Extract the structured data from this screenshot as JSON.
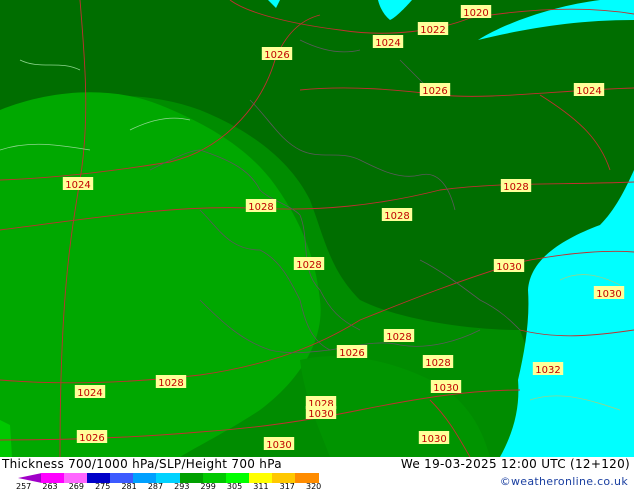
{
  "title": "Thickness 700/1000 hPa/SLP/Height 700 hPa",
  "valid_time": "We 19-03-2025 12:00 UTC (12+120)",
  "credit": "©weatheronline.co.uk",
  "colors": {
    "ocean": "#00ffff",
    "dark_green": "#006e00",
    "mid_green": "#008c00",
    "light_green": "#00a800",
    "isobar": "#c03030",
    "border": "#5a5a5a",
    "label_bg": "#ffff99",
    "label_text": "#c00000"
  },
  "scale": {
    "ticks": [
      "257",
      "263",
      "269",
      "275",
      "281",
      "287",
      "293",
      "299",
      "305",
      "311",
      "317",
      "320"
    ],
    "colors": [
      "#a000c8",
      "#ff00ff",
      "#ff66ff",
      "#0000c8",
      "#3c5aff",
      "#00a0ff",
      "#00d2ff",
      "#00a000",
      "#00c800",
      "#00ff00",
      "#ffff00",
      "#ffc800",
      "#ff8c00"
    ]
  },
  "pressure_labels": [
    {
      "text": "1020"
    },
    {
      "text": "1022"
    },
    {
      "text": "1024"
    },
    {
      "text": "1026"
    },
    {
      "text": "1026"
    },
    {
      "text": "1024"
    },
    {
      "text": "1024"
    },
    {
      "text": "1028"
    },
    {
      "text": "1028"
    },
    {
      "text": "1028"
    },
    {
      "text": "1028"
    },
    {
      "text": "1030"
    },
    {
      "text": "1030"
    },
    {
      "text": "1028"
    },
    {
      "text": "1026"
    },
    {
      "text": "1028"
    },
    {
      "text": "1024"
    },
    {
      "text": "1028"
    },
    {
      "text": "1030"
    },
    {
      "text": "1032"
    },
    {
      "text": "1028"
    },
    {
      "text": "1030"
    },
    {
      "text": "1026"
    },
    {
      "text": "1030"
    },
    {
      "text": "1030"
    }
  ]
}
